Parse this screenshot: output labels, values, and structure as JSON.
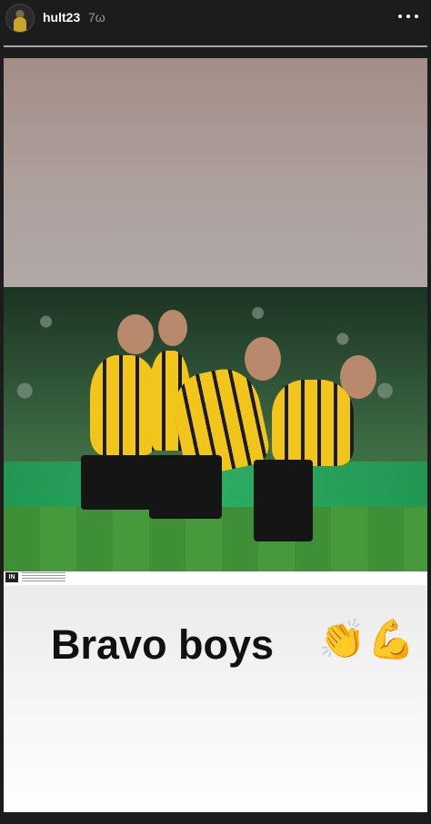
{
  "header": {
    "username": "hult23",
    "time_ago": "7ω"
  },
  "story": {
    "caption": "Bravo boys",
    "emoji_clap": "👏",
    "emoji_muscle": "💪",
    "press_logo": "IN"
  },
  "icons": {
    "menu": "more-options-icon"
  }
}
